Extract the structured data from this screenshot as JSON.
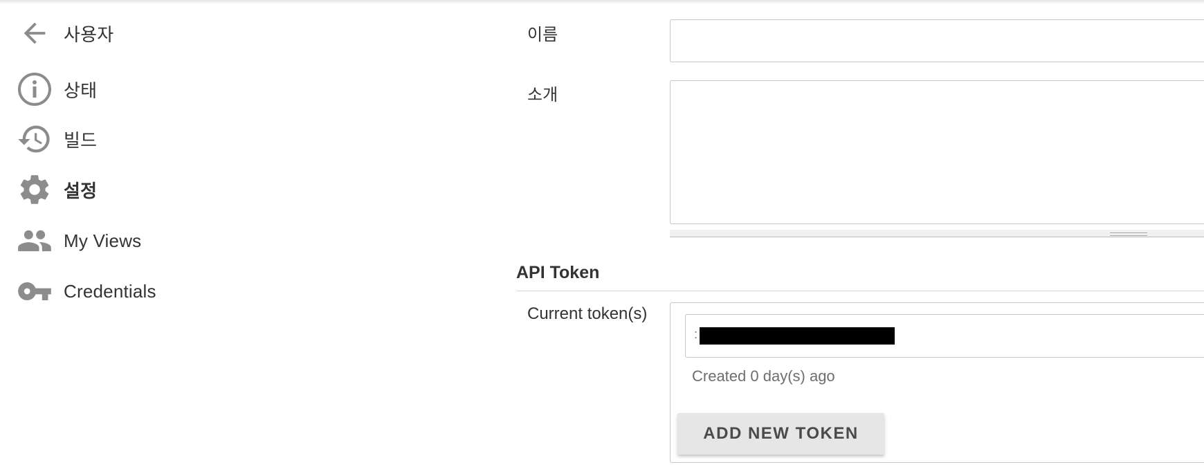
{
  "sidebar": {
    "items": [
      {
        "label": "사용자",
        "icon": "arrow-left-icon"
      },
      {
        "label": "상태",
        "icon": "info-icon"
      },
      {
        "label": "빌드",
        "icon": "history-icon"
      },
      {
        "label": "설정",
        "icon": "gear-icon",
        "active": true
      },
      {
        "label": "My Views",
        "icon": "people-icon"
      },
      {
        "label": "Credentials",
        "icon": "key-icon"
      }
    ],
    "icon_color": "#8c8c8c"
  },
  "form": {
    "name_label": "이름",
    "name_value": "",
    "description_label": "소개",
    "description_value": ""
  },
  "api_token": {
    "section_title": "API Token",
    "current_tokens_label": "Current token(s)",
    "token_prefix": ":",
    "token_created": "Created 0 day(s) ago",
    "add_button_label": "ADD NEW TOKEN"
  }
}
